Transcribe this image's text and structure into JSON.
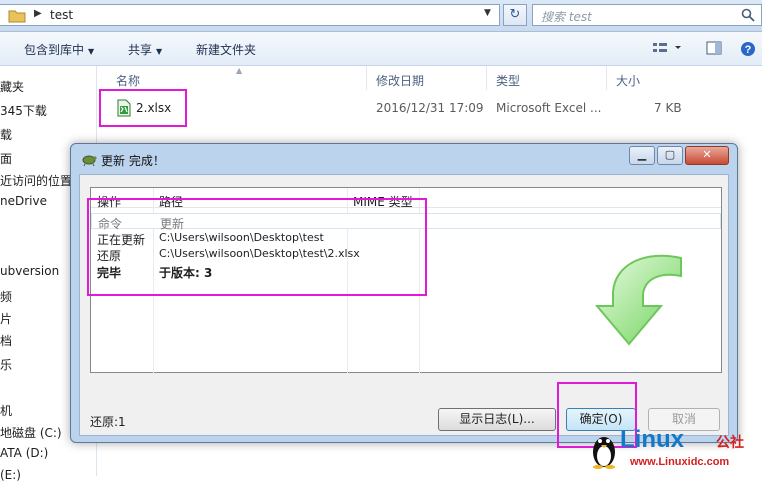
{
  "explorer": {
    "path_segment": "test",
    "search_placeholder": "搜索 test",
    "toolbar": {
      "include_in_library": "包含到库中",
      "share": "共享",
      "new_folder": "新建文件夹"
    },
    "nav_items": [
      "藏夹",
      "345下载",
      "载",
      "面",
      "近访问的位置",
      "neDrive",
      "ubversion",
      "频",
      "片",
      "档",
      "乐",
      "机",
      "地磁盘 (C:)",
      "ATA (D:)",
      "(E:)"
    ],
    "columns": {
      "name": "名称",
      "modified": "修改日期",
      "type": "类型",
      "size": "大小"
    },
    "files": [
      {
        "name": "2.xlsx",
        "modified": "2016/12/31 17:09",
        "type": "Microsoft Excel ...",
        "size": "7 KB"
      }
    ]
  },
  "dialog": {
    "title": "更新 完成！",
    "list_columns": {
      "action": "操作",
      "path": "路径",
      "mime": "MIME 类型"
    },
    "rows": [
      {
        "action": "命令",
        "path": "更新",
        "style": "selected"
      },
      {
        "action": "正在更新",
        "path": "C:\\Users\\wilsoon\\Desktop\\test",
        "style": "normal"
      },
      {
        "action": "还原",
        "path": "C:\\Users\\wilsoon\\Desktop\\test\\2.xlsx",
        "style": "normal"
      },
      {
        "action": "完毕",
        "path": "于版本: 3",
        "style": "bold"
      }
    ],
    "status": "还原:1",
    "buttons": {
      "show_log": "显示日志(L)...",
      "ok": "确定(O)",
      "cancel": "取消"
    }
  },
  "watermark": {
    "brand": "Linux",
    "badge": "公社",
    "url": "www.Linuxidc.com"
  },
  "colors": {
    "highlight": "#e11ad8",
    "dialog_frame": "#bcd3ee",
    "arrow_green": "#7fd86a"
  }
}
